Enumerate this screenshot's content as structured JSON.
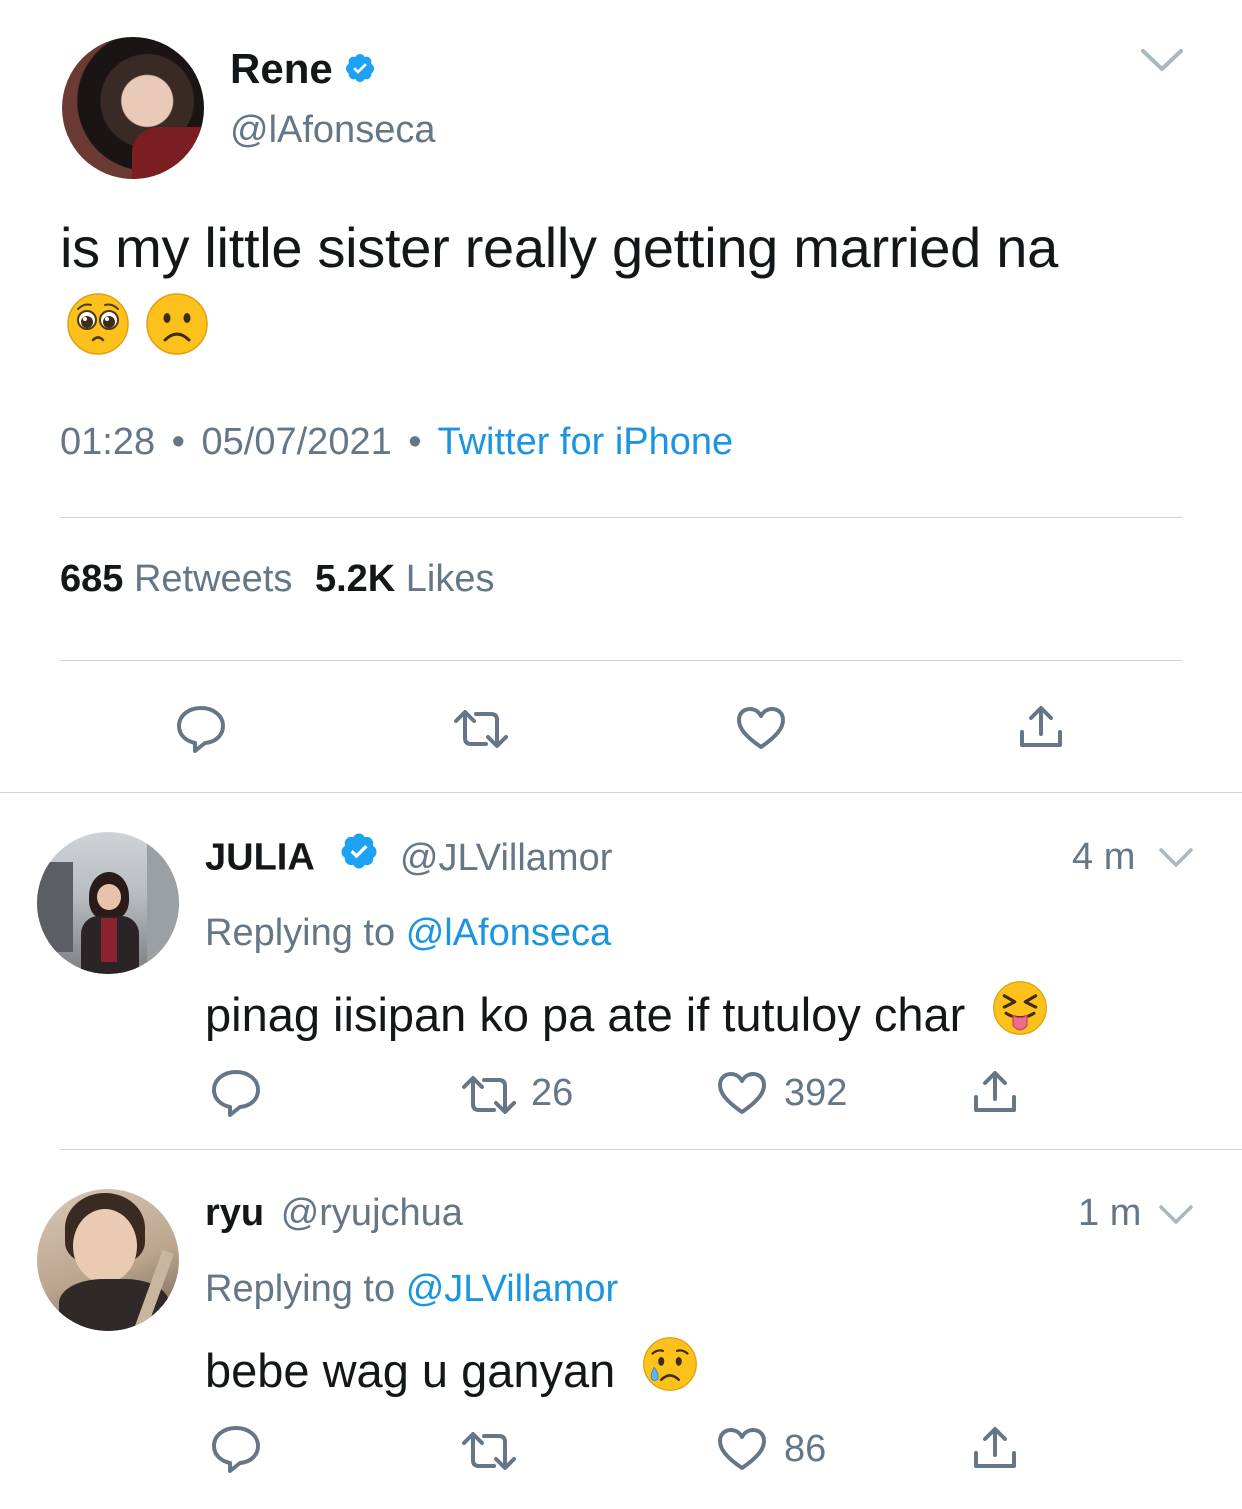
{
  "main_tweet": {
    "display_name": "Rene",
    "handle": "@lAfonseca",
    "text": "is my little sister really getting married na",
    "time": "01:28",
    "dot1": "•",
    "date": "05/07/2021",
    "dot2": "•",
    "source": "Twitter for iPhone",
    "retweets_count": "685",
    "retweets_label": "Retweets",
    "likes_count": "5.2K",
    "likes_label": "Likes",
    "emojis": [
      "pleading-face",
      "slightly-frowning-face"
    ]
  },
  "replies": [
    {
      "display_name": "JULIA",
      "handle": "@JLVillamor",
      "verified": true,
      "age": "4 m",
      "replying_prefix": "Replying to",
      "replying_to": "@lAfonseca",
      "text": "pinag iisipan ko pa ate if tutuloy char",
      "emoji": "squinting-face-with-tongue",
      "retweets": "26",
      "likes": "392"
    },
    {
      "display_name": "ryu",
      "handle": "@ryujchua",
      "verified": false,
      "age": "1 m",
      "replying_prefix": "Replying to",
      "replying_to": "@JLVillamor",
      "text": "bebe wag u ganyan",
      "emoji": "crying-face",
      "retweets": "",
      "likes": "86"
    }
  ],
  "colors": {
    "text": "#14171a",
    "secondary": "#657786",
    "link": "#1b95e0",
    "divider": "#ccd6dd"
  }
}
